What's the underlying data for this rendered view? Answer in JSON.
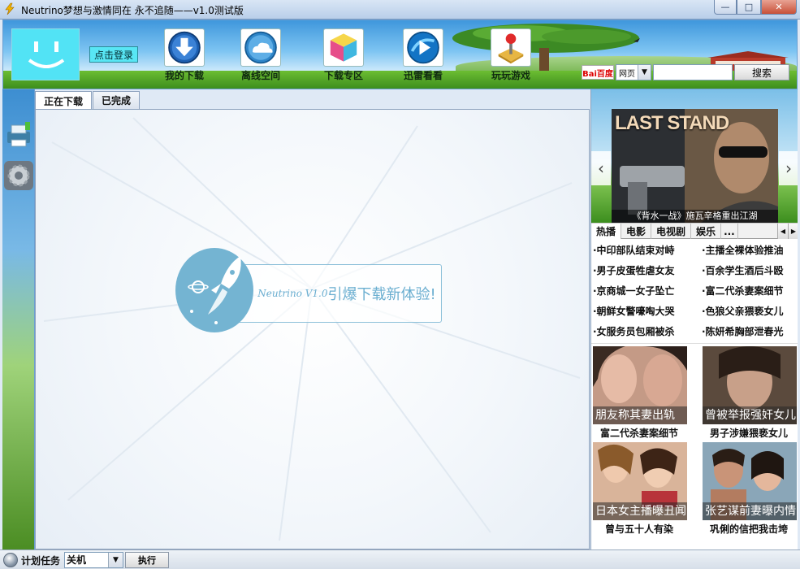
{
  "window": {
    "title": "Neutrino梦想与激情同在  永不追随——v1.0测试版",
    "minimize": "—",
    "maximize": "□",
    "close": "✕"
  },
  "header": {
    "login_label": "点击登录",
    "nav": [
      {
        "label": "我的下载",
        "icon": "download-arrow-icon"
      },
      {
        "label": "离线空间",
        "icon": "cloud-icon"
      },
      {
        "label": "下载专区",
        "icon": "cube-icon"
      },
      {
        "label": "迅雷看看",
        "icon": "play-icon"
      },
      {
        "label": "玩玩游戏",
        "icon": "joystick-icon"
      }
    ],
    "search": {
      "logo_text": "Bai百度",
      "engine": "网页",
      "query": "",
      "button": "搜索"
    }
  },
  "left_bar": {
    "tools": [
      {
        "icon": "printer-icon"
      },
      {
        "icon": "gear-icon"
      }
    ]
  },
  "tabs": [
    {
      "label": "正在下载",
      "active": true
    },
    {
      "label": "已完成",
      "active": false
    }
  ],
  "splash": {
    "brand": "Neutrino V1.0",
    "slogan": "引爆下载新体验!",
    "icon": "rocket-icon"
  },
  "right_panel": {
    "banner": {
      "poster_title": "LAST STAND",
      "caption": "《背水一战》施瓦辛格重出江湖"
    },
    "news_tabs": [
      "热播",
      "电影",
      "电视剧",
      "娱乐",
      "..."
    ],
    "news": [
      "·中印部队结束对峙",
      "·主播全裸体验推油",
      "·男子皮蛋牲虐女友",
      "·百余学生酒后斗殴",
      "·京商城一女子坠亡",
      "·富二代杀妻案细节",
      "·朝鲜女警嚎啕大哭",
      "·色狼父亲猥亵女儿",
      "·女服务员包厢被杀",
      "·陈妍希胸部泄春光"
    ],
    "pictures": [
      {
        "caption": "朋友称其妻出轨",
        "title": "富二代杀妻案细节"
      },
      {
        "caption": "曾被举报强奸女儿",
        "title": "男子涉嫌猥亵女儿"
      },
      {
        "caption": "日本女主播曝丑闻",
        "title": "曾与五十人有染"
      },
      {
        "caption": "张艺谋前妻曝内情",
        "title": "巩俐的信把我击垮"
      }
    ]
  },
  "statusbar": {
    "label": "计划任务",
    "option": "关机",
    "execute": "执行"
  },
  "colors": {
    "sky": "#3f97dc",
    "grass": "#4d9e26",
    "splash_blue": "#74b4d2",
    "avatar": "#52e3f5"
  }
}
